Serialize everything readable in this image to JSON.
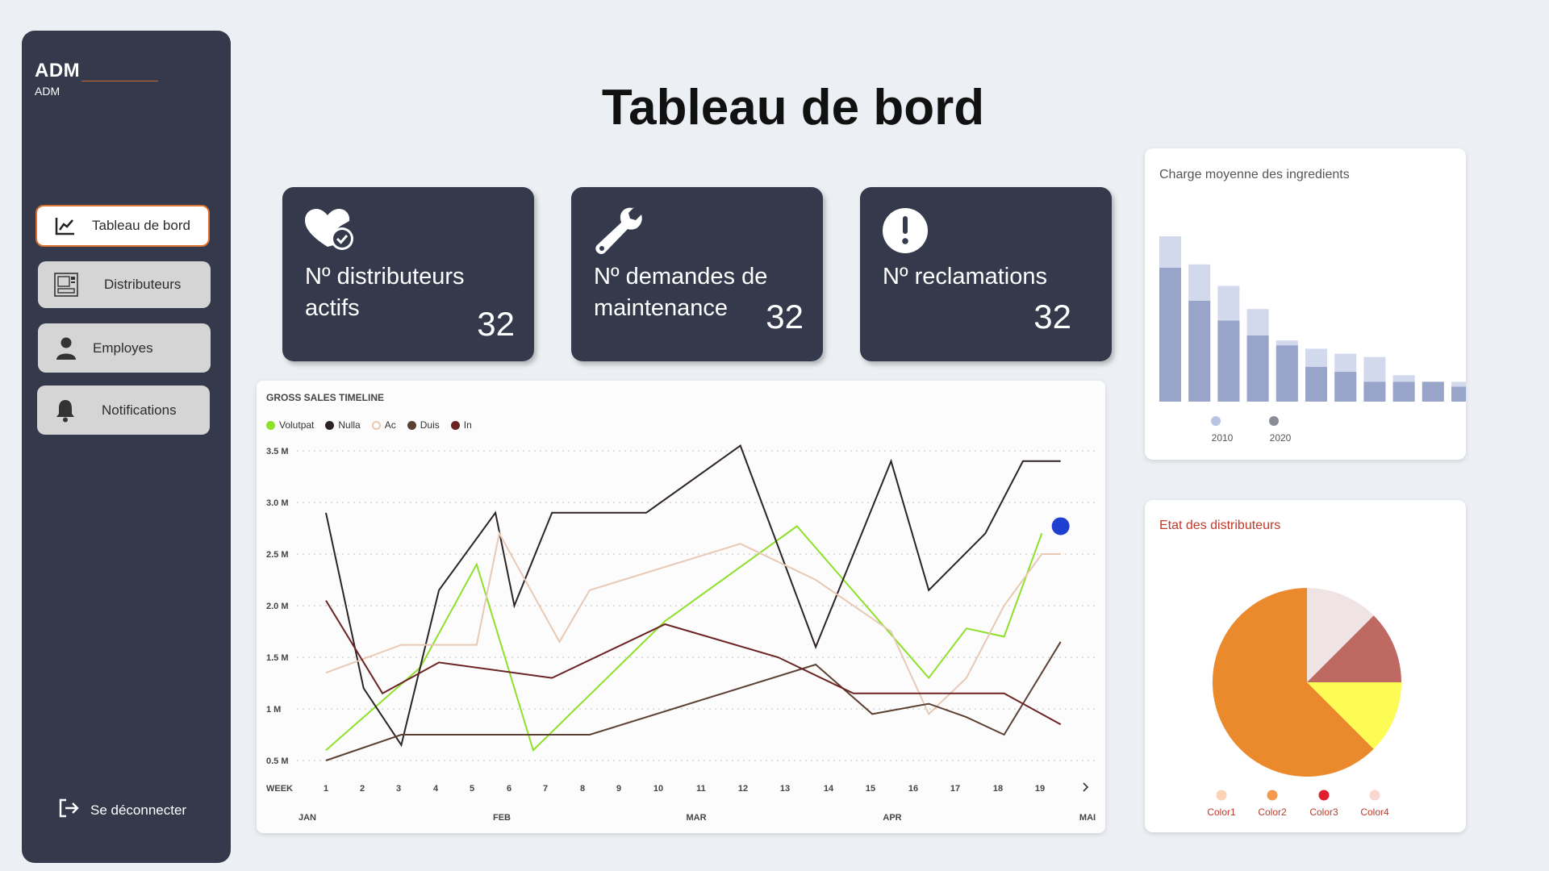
{
  "sidebar": {
    "brand_title": "ADM",
    "brand_sub": "ADM",
    "items": [
      {
        "label": "Tableau de bord",
        "icon": "chart-line-icon",
        "active": true
      },
      {
        "label": "Distributeurs",
        "icon": "vending-machine-icon",
        "active": false
      },
      {
        "label": "Employes",
        "icon": "person-icon",
        "active": false
      },
      {
        "label": "Notifications",
        "icon": "bell-icon",
        "active": false
      }
    ],
    "logout_label": "Se déconnecter"
  },
  "page_title": "Tableau de bord",
  "cards": [
    {
      "label": "Nº distributeurs actifs",
      "value": "32",
      "icon": "heart-check-icon"
    },
    {
      "label": "Nº demandes de maintenance",
      "value": "32",
      "icon": "wrench-icon"
    },
    {
      "label": "Nº reclamations",
      "value": "32",
      "icon": "exclamation-circle-icon"
    }
  ],
  "colors": {
    "sidebar_bg": "#343a4b",
    "accent": "#d9712f",
    "page_bg": "#eceff3"
  },
  "chart_data": [
    {
      "type": "line",
      "title": "GROSS SALES TIMELINE",
      "xlabel": "WEEK",
      "x": [
        "1",
        "2",
        "3",
        "4",
        "5",
        "6",
        "7",
        "8",
        "9",
        "10",
        "11",
        "12",
        "13",
        "14",
        "15",
        "16",
        "17",
        "18",
        "19"
      ],
      "x_extra": ">",
      "months": [
        "JAN",
        "FEB",
        "MAR",
        "APR",
        "MAI"
      ],
      "y_ticks": [
        "3.5 M",
        "3.0 M",
        "2.5 M",
        "2.0 M",
        "1.5 M",
        "1 M",
        "0.5 M"
      ],
      "ylim": [
        0.5,
        3.5
      ],
      "grid": true,
      "legend_position": "top-left",
      "series": [
        {
          "name": "Volutpat",
          "color": "#8ee02a",
          "points": [
            [
              1,
              0.6
            ],
            [
              3.5,
              1.4
            ],
            [
              5,
              2.4
            ],
            [
              6.5,
              0.6
            ],
            [
              10,
              1.85
            ],
            [
              13.5,
              2.77
            ],
            [
              17,
              1.3
            ],
            [
              18,
              1.78
            ],
            [
              19,
              1.7
            ],
            [
              20,
              2.7
            ]
          ]
        },
        {
          "name": "Nulla",
          "color": "#2c2323",
          "points": [
            [
              1,
              2.9
            ],
            [
              2,
              1.2
            ],
            [
              3,
              0.65
            ],
            [
              4,
              2.15
            ],
            [
              5.5,
              2.9
            ],
            [
              6,
              2
            ],
            [
              7,
              2.9
            ],
            [
              9.5,
              2.9
            ],
            [
              12,
              3.55
            ],
            [
              14,
              1.6
            ],
            [
              16,
              3.4
            ],
            [
              17,
              2.15
            ],
            [
              18.5,
              2.7
            ],
            [
              19.5,
              3.4
            ],
            [
              20.5,
              3.4
            ]
          ]
        },
        {
          "name": "Ac",
          "color": "#e8c9b4",
          "points": [
            [
              1,
              1.35
            ],
            [
              3,
              1.62
            ],
            [
              5,
              1.62
            ],
            [
              5.6,
              2.7
            ],
            [
              7.2,
              1.65
            ],
            [
              8,
              2.15
            ],
            [
              12,
              2.6
            ],
            [
              14,
              2.25
            ],
            [
              16,
              1.75
            ],
            [
              17,
              0.95
            ],
            [
              18,
              1.3
            ],
            [
              19,
              2.0
            ],
            [
              20,
              2.5
            ],
            [
              20.5,
              2.5
            ]
          ]
        },
        {
          "name": "Duis",
          "color": "#5c4033",
          "points": [
            [
              1,
              0.5
            ],
            [
              3,
              0.75
            ],
            [
              6,
              0.75
            ],
            [
              8,
              0.75
            ],
            [
              14,
              1.43
            ],
            [
              15.5,
              0.95
            ],
            [
              17,
              1.05
            ],
            [
              18,
              0.92
            ],
            [
              19,
              0.75
            ],
            [
              20.5,
              1.65
            ]
          ]
        },
        {
          "name": "In",
          "color": "#6b2323",
          "points": [
            [
              1,
              2.05
            ],
            [
              2.5,
              1.15
            ],
            [
              4,
              1.45
            ],
            [
              7,
              1.3
            ],
            [
              10,
              1.82
            ],
            [
              13,
              1.5
            ],
            [
              15,
              1.15
            ],
            [
              17,
              1.15
            ],
            [
              18,
              1.15
            ],
            [
              19,
              1.15
            ],
            [
              20.5,
              0.85
            ]
          ]
        }
      ],
      "highlight_point": {
        "x": 20.5,
        "y": 2.77,
        "color": "#1f3fd1"
      }
    },
    {
      "type": "bar",
      "title": "Charge moyenne des ingredients",
      "series": [
        {
          "name": "2010",
          "color": "#d3d9ec",
          "values": [
            100,
            83,
            70,
            56,
            37,
            32,
            29,
            27,
            16,
            12,
            12
          ]
        },
        {
          "name": "2020",
          "color": "#98a4c9",
          "values": [
            81,
            61,
            49,
            40,
            34,
            21,
            18,
            12,
            12,
            12,
            9
          ]
        }
      ],
      "legend_position": "bottom-left"
    },
    {
      "type": "pie",
      "title": "Etat des distributeurs",
      "slices": [
        {
          "name": "Color1",
          "value": 12.5,
          "color": "#efe3e3",
          "legend_color": "#fcd3b6"
        },
        {
          "name": "Color2",
          "value": 12.5,
          "color": "#bf6963",
          "legend_color": "#f29a4f"
        },
        {
          "name": "Color3",
          "value": 12.5,
          "color": "#fdfc55",
          "legend_color": "#e01f2f"
        },
        {
          "name": "Color4",
          "value": 62.5,
          "color": "#eb8a2d",
          "legend_color": "#fad6d1"
        }
      ],
      "legend_position": "bottom"
    }
  ]
}
